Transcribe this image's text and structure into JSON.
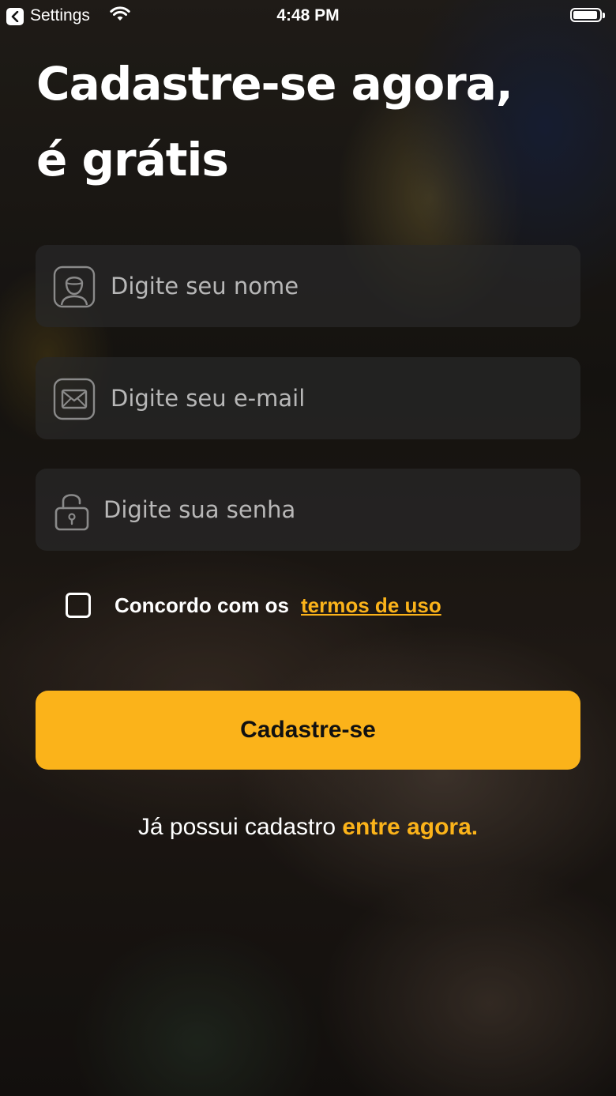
{
  "status_bar": {
    "back_app": "Settings",
    "time": "4:48 PM",
    "battery_level": 0.95
  },
  "title": {
    "line1": "Cadastre-se agora,",
    "line2": "é grátis"
  },
  "form": {
    "name": {
      "placeholder": "Digite seu nome",
      "value": "",
      "icon": "user-icon"
    },
    "email": {
      "placeholder": "Digite seu e-mail",
      "value": "",
      "icon": "mail-icon"
    },
    "password": {
      "placeholder": "Digite sua senha",
      "value": "",
      "icon": "unlock-icon"
    }
  },
  "terms": {
    "checked": false,
    "text": "Concordo com os",
    "link": "termos de uso"
  },
  "submit_label": "Cadastre-se",
  "login": {
    "prompt": "Já possui cadastro",
    "link": "entre agora."
  },
  "colors": {
    "accent": "#fbb31a",
    "field_background": "#282828",
    "text": "#ffffff"
  }
}
